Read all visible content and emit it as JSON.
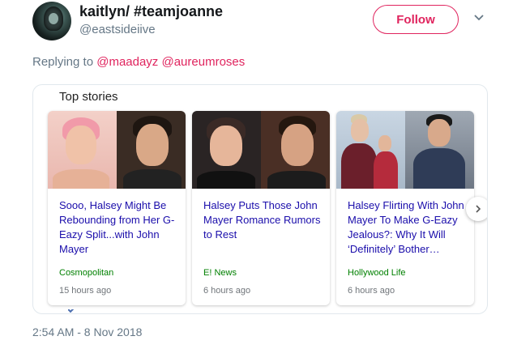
{
  "tweet": {
    "display_name": "kaitlyn/ #teamjoanne",
    "handle": "@eastsideiive",
    "follow_label": "Follow",
    "replying_prefix": "Replying to",
    "mentions": [
      "@maadayz",
      "@aureumroses"
    ],
    "timestamp": "2:54 AM - 8 Nov 2018"
  },
  "top_stories": {
    "title": "Top stories",
    "items": [
      {
        "headline": "Sooo, Halsey Might Be Rebounding from Her G-Eazy Split...with John Mayer",
        "source": "Cosmopolitan",
        "time": "15 hours ago"
      },
      {
        "headline": "Halsey Puts Those John Mayer Romance Rumors to Rest",
        "source": "E! News",
        "time": "6 hours ago"
      },
      {
        "headline": "Halsey Flirting With John Mayer To Make G-Eazy Jealous?: Why It Will ‘Definitely’ Bother…",
        "source": "Hollywood Life",
        "time": "6 hours ago"
      }
    ]
  },
  "colors": {
    "accent": "#e0245e",
    "link": "#1a0dab",
    "source": "#008000",
    "muted": "#657786"
  },
  "icons": [
    "caret-down-icon",
    "chevron-right-icon"
  ]
}
